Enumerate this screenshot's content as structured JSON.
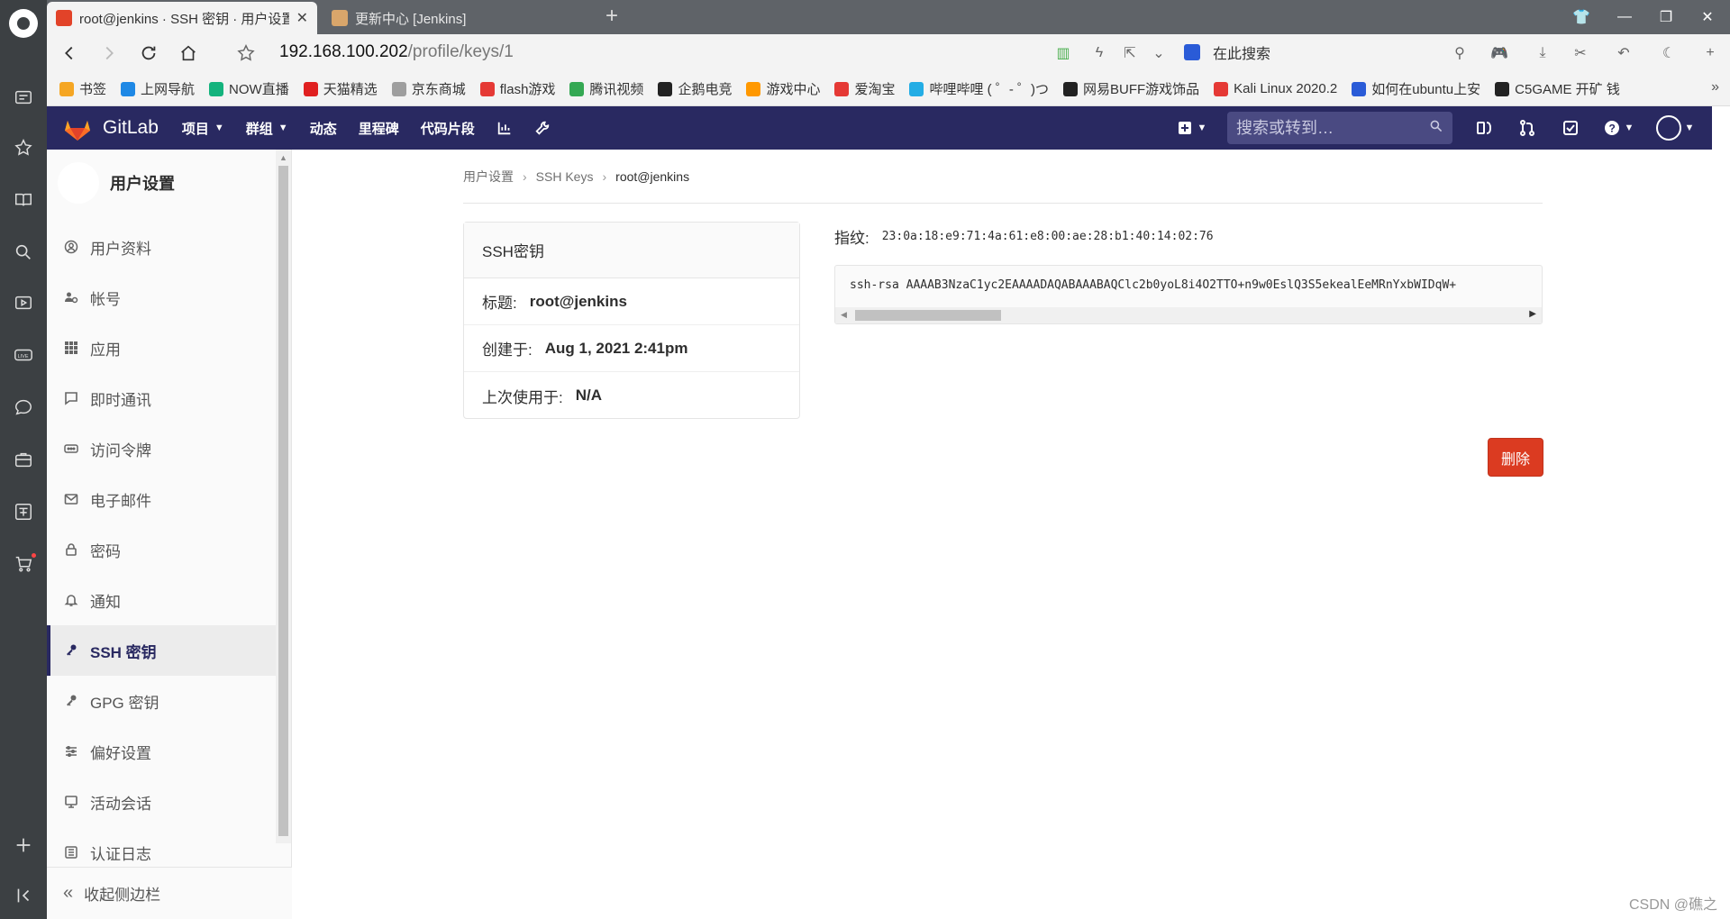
{
  "browser": {
    "tabs": [
      {
        "title": "root@jenkins · SSH 密钥 · 用户设置",
        "active": true
      },
      {
        "title": "更新中心 [Jenkins]",
        "active": false
      }
    ],
    "url_host": "192.168.100.202",
    "url_path": "/profile/keys/1",
    "search_placeholder": "在此搜索",
    "bookmarks": [
      {
        "label": "书签",
        "color": "#f5a623"
      },
      {
        "label": "上网导航",
        "color": "#1e88e5"
      },
      {
        "label": "NOW直播",
        "color": "#14b37d"
      },
      {
        "label": "天猫精选",
        "color": "#e02020"
      },
      {
        "label": "京东商城",
        "color": "#9e9e9e"
      },
      {
        "label": "flash游戏",
        "color": "#e53935"
      },
      {
        "label": "腾讯视频",
        "color": "#34a853"
      },
      {
        "label": "企鹅电竞",
        "color": "#222222"
      },
      {
        "label": "游戏中心",
        "color": "#ff9800"
      },
      {
        "label": "爱淘宝",
        "color": "#e53935"
      },
      {
        "label": "哔哩哔哩 ( ゜- ゜)つ",
        "color": "#23ade5"
      },
      {
        "label": "网易BUFF游戏饰品",
        "color": "#222222"
      },
      {
        "label": "Kali Linux 2020.2",
        "color": "#e53935"
      },
      {
        "label": "如何在ubuntu上安",
        "color": "#2a5bd7"
      },
      {
        "label": "C5GAME 开矿 钱",
        "color": "#222222"
      }
    ]
  },
  "gitlab": {
    "brand": "GitLab",
    "menu": [
      {
        "label": "项目",
        "dropdown": true
      },
      {
        "label": "群组",
        "dropdown": true
      },
      {
        "label": "动态",
        "dropdown": false
      },
      {
        "label": "里程碑",
        "dropdown": false
      },
      {
        "label": "代码片段",
        "dropdown": false
      }
    ],
    "search_placeholder": "搜索或转到…"
  },
  "sidebar": {
    "title": "用户设置",
    "items": [
      {
        "label": "用户资料",
        "icon": "user-icon",
        "active": false
      },
      {
        "label": "帐号",
        "icon": "account-gear-icon",
        "active": false
      },
      {
        "label": "应用",
        "icon": "apps-grid-icon",
        "active": false
      },
      {
        "label": "即时通讯",
        "icon": "chat-icon",
        "active": false
      },
      {
        "label": "访问令牌",
        "icon": "token-icon",
        "active": false
      },
      {
        "label": "电子邮件",
        "icon": "mail-icon",
        "active": false
      },
      {
        "label": "密码",
        "icon": "lock-icon",
        "active": false
      },
      {
        "label": "通知",
        "icon": "bell-icon",
        "active": false
      },
      {
        "label": "SSH 密钥",
        "icon": "key-icon",
        "active": true
      },
      {
        "label": "GPG 密钥",
        "icon": "key-icon",
        "active": false
      },
      {
        "label": "偏好设置",
        "icon": "sliders-icon",
        "active": false
      },
      {
        "label": "活动会话",
        "icon": "monitor-icon",
        "active": false
      },
      {
        "label": "认证日志",
        "icon": "log-icon",
        "active": false
      }
    ],
    "collapse_label": "收起侧边栏"
  },
  "breadcrumb": [
    "用户设置",
    "SSH Keys",
    "root@jenkins"
  ],
  "key_card": {
    "header": "SSH密钥",
    "title_label": "标题:",
    "title_value": "root@jenkins",
    "created_label": "创建于:",
    "created_value": "Aug 1, 2021 2:41pm",
    "last_used_label": "上次使用于:",
    "last_used_value": "N/A"
  },
  "fingerprint_label": "指纹:",
  "fingerprint_value": "23:0a:18:e9:71:4a:61:e8:00:ae:28:b1:40:14:02:76",
  "key_text": "ssh-rsa AAAAB3NzaC1yc2EAAAADAQABAAABAQClc2b0yoL8i4O2TTO+n9w0EslQ3S5ekealEeMRnYxbWIDqW+",
  "delete_label": "删除",
  "watermark": "CSDN @礁之"
}
